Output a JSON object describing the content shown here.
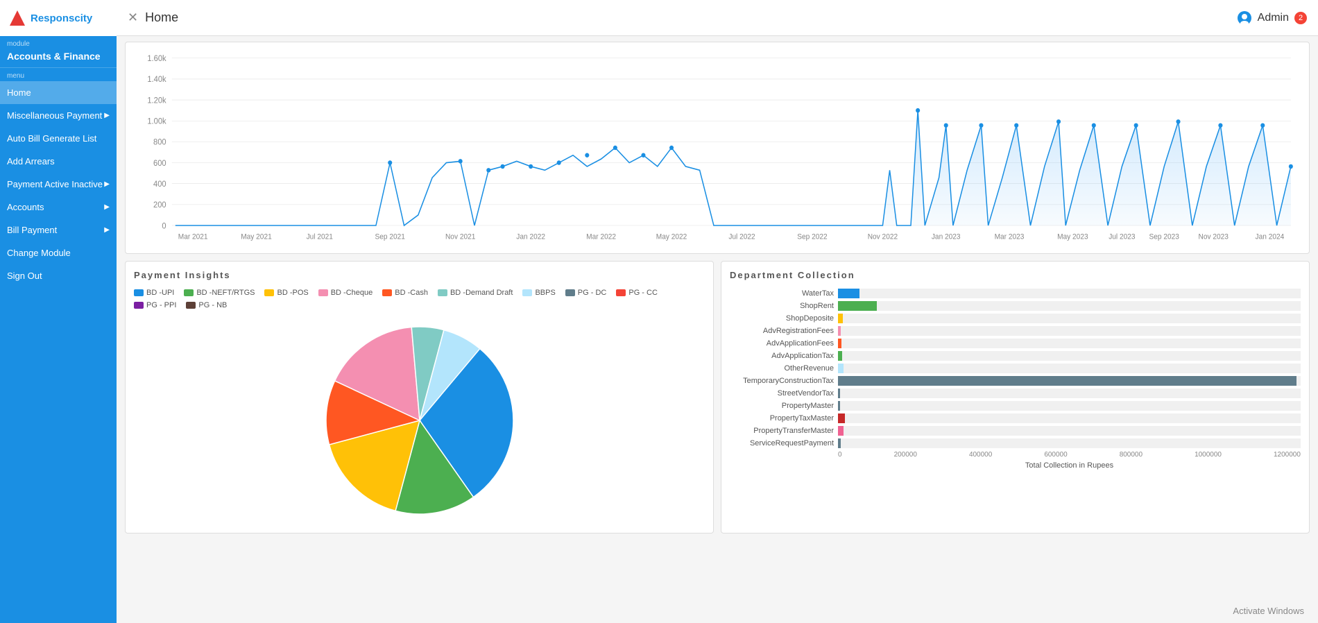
{
  "app": {
    "logo_text": "Responscity",
    "window_title": "Activate Windows"
  },
  "sidebar": {
    "module_label": "module",
    "module_name": "Accounts & Finance",
    "menu_label": "menu",
    "items": [
      {
        "label": "Home",
        "active": true,
        "has_arrow": false
      },
      {
        "label": "Miscellaneous Payment",
        "active": false,
        "has_arrow": true
      },
      {
        "label": "Auto Bill Generate List",
        "active": false,
        "has_arrow": false
      },
      {
        "label": "Add Arrears",
        "active": false,
        "has_arrow": false
      },
      {
        "label": "Payment Active Inactive",
        "active": false,
        "has_arrow": true
      },
      {
        "label": "Accounts",
        "active": false,
        "has_arrow": true
      },
      {
        "label": "Bill Payment",
        "active": false,
        "has_arrow": true
      },
      {
        "label": "Change Module",
        "active": false,
        "has_arrow": false
      },
      {
        "label": "Sign Out",
        "active": false,
        "has_arrow": false
      }
    ]
  },
  "topbar": {
    "title": "Home",
    "admin_label": "Admin",
    "admin_badge": "2"
  },
  "payment_insights": {
    "title": "Payment Insights",
    "legend": [
      {
        "label": "BD -UPI",
        "color": "#1a8fe3"
      },
      {
        "label": "BD -NEFT/RTGS",
        "color": "#4caf50"
      },
      {
        "label": "BD -POS",
        "color": "#ffc107"
      },
      {
        "label": "BD -Cheque",
        "color": "#f48fb1"
      },
      {
        "label": "BD -Cash",
        "color": "#ff5722"
      },
      {
        "label": "BD -Demand Draft",
        "color": "#80cbc4"
      },
      {
        "label": "BBPS",
        "color": "#b3e5fc"
      },
      {
        "label": "PG - DC",
        "color": "#607d8b"
      },
      {
        "label": "PG - CC",
        "color": "#f44336"
      },
      {
        "label": "PG - PPI",
        "color": "#7b1fa2"
      },
      {
        "label": "PG - NB",
        "color": "#5d4037"
      }
    ],
    "pie_segments": [
      {
        "color": "#1a8fe3",
        "percent": 38,
        "start": 0
      },
      {
        "color": "#4caf50",
        "percent": 12,
        "start": 38
      },
      {
        "color": "#ffc107",
        "percent": 14,
        "start": 50
      },
      {
        "color": "#ff5722",
        "percent": 10,
        "start": 64
      },
      {
        "color": "#f48fb1",
        "percent": 13,
        "start": 74
      },
      {
        "color": "#80cbc4",
        "percent": 5,
        "start": 87
      },
      {
        "color": "#b3e5fc",
        "percent": 8,
        "start": 92
      }
    ]
  },
  "department_collection": {
    "title": "Department Collection",
    "x_label": "Total Collection in Rupees",
    "x_ticks": [
      "0",
      "200000",
      "400000",
      "600000",
      "800000",
      "1000000",
      "1200000"
    ],
    "max_value": 1200000,
    "bars": [
      {
        "label": "WaterTax",
        "value": 55000,
        "color": "#1a8fe3"
      },
      {
        "label": "ShopRent",
        "value": 100000,
        "color": "#4caf50"
      },
      {
        "label": "ShopDeposite",
        "value": 12000,
        "color": "#ffc107"
      },
      {
        "label": "AdvRegistrationFees",
        "value": 8000,
        "color": "#f48fb1"
      },
      {
        "label": "AdvApplicationFees",
        "value": 9000,
        "color": "#ff5722"
      },
      {
        "label": "AdvApplicationTax",
        "value": 11000,
        "color": "#4caf50"
      },
      {
        "label": "OtherRevenue",
        "value": 15000,
        "color": "#b3e5fc"
      },
      {
        "label": "TemporaryConstructionTax",
        "value": 1190000,
        "color": "#607d8b"
      },
      {
        "label": "StreetVendorTax",
        "value": 6000,
        "color": "#607d8b"
      },
      {
        "label": "PropertyMaster",
        "value": 5000,
        "color": "#607d8b"
      },
      {
        "label": "PropertyTaxMaster",
        "value": 18000,
        "color": "#c62828"
      },
      {
        "label": "PropertyTransferMaster",
        "value": 14000,
        "color": "#f06292"
      },
      {
        "label": "ServiceRequestPayment",
        "value": 7000,
        "color": "#607d8b"
      }
    ]
  },
  "line_chart": {
    "y_labels": [
      "1.60k",
      "1.40k",
      "1.20k",
      "1.00k",
      "800",
      "600",
      "400",
      "200",
      "0"
    ],
    "x_labels": [
      "Mar 2021",
      "May 2021",
      "Jul 2021",
      "Sep 2021",
      "Nov 2021",
      "Jan 2022",
      "Mar 2022",
      "May 2022",
      "Jul 2022",
      "Sep 2022",
      "Nov 2022",
      "Jan 2023",
      "Mar 2023",
      "May 2023",
      "Jul 2023",
      "Sep 2023",
      "Nov 2023",
      "Jan 2024"
    ]
  }
}
